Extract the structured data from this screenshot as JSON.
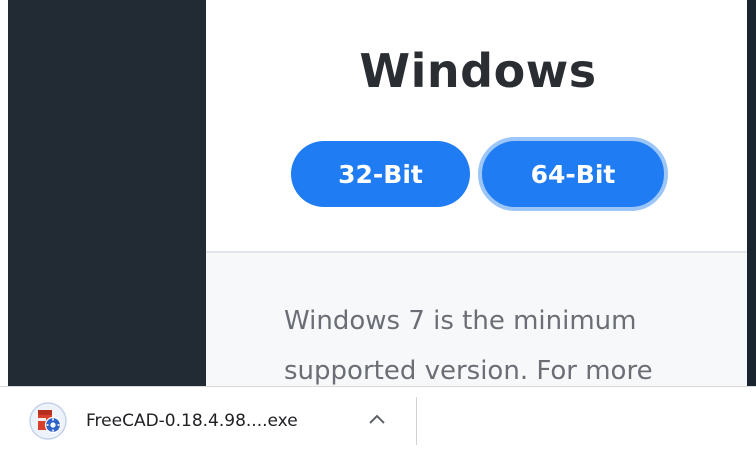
{
  "card": {
    "title": "Windows",
    "buttons": {
      "bit32": "32-Bit",
      "bit64": "64-Bit"
    },
    "requirements": "Windows 7 is the minimum supported version. For more"
  },
  "download_bar": {
    "file_name": "FreeCAD-0.18.4.98....exe",
    "file_icon": "freecad-file-icon",
    "menu_icon": "chevron-up-icon"
  },
  "colors": {
    "accent": "#1f7cf2",
    "focus_ring": "#9cc6f7",
    "dark_panel": "#222a33"
  }
}
